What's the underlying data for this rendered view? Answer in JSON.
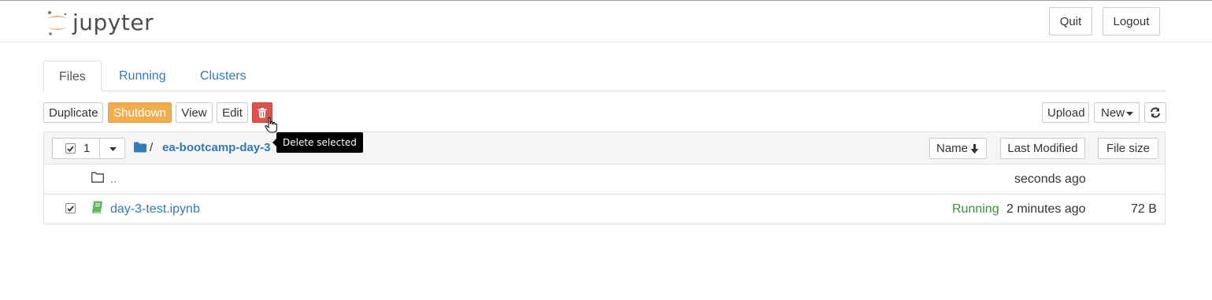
{
  "header": {
    "logo_text": "jupyter",
    "quit_label": "Quit",
    "logout_label": "Logout"
  },
  "tabs": [
    {
      "label": "Files",
      "active": true
    },
    {
      "label": "Running",
      "active": false
    },
    {
      "label": "Clusters",
      "active": false
    }
  ],
  "toolbar": {
    "duplicate_label": "Duplicate",
    "shutdown_label": "Shutdown",
    "view_label": "View",
    "edit_label": "Edit",
    "delete_icon": "trash-icon",
    "upload_label": "Upload",
    "new_label": "New",
    "refresh_icon": "refresh-icon"
  },
  "tooltip": {
    "text": "Delete selected"
  },
  "list_header": {
    "selected_count": "1",
    "breadcrumb_separator": "/",
    "breadcrumb_folder": "ea-bootcamp-day-3",
    "sort_name_label": "Name",
    "sort_modified_label": "Last Modified",
    "sort_size_label": "File size"
  },
  "rows": [
    {
      "name": "..",
      "status": "",
      "modified": "seconds ago",
      "size": "",
      "checked": false,
      "type": "folder"
    },
    {
      "name": "day-3-test.ipynb",
      "status": "Running",
      "modified": "2 minutes ago",
      "size": "72 B",
      "checked": true,
      "type": "notebook"
    }
  ],
  "colors": {
    "link": "#337ab7",
    "warning": "#f0ad4e",
    "danger": "#d9534f",
    "running": "#5cb85c",
    "notebook_icon": "#5cb85c",
    "logo_orange": "#f37726"
  }
}
